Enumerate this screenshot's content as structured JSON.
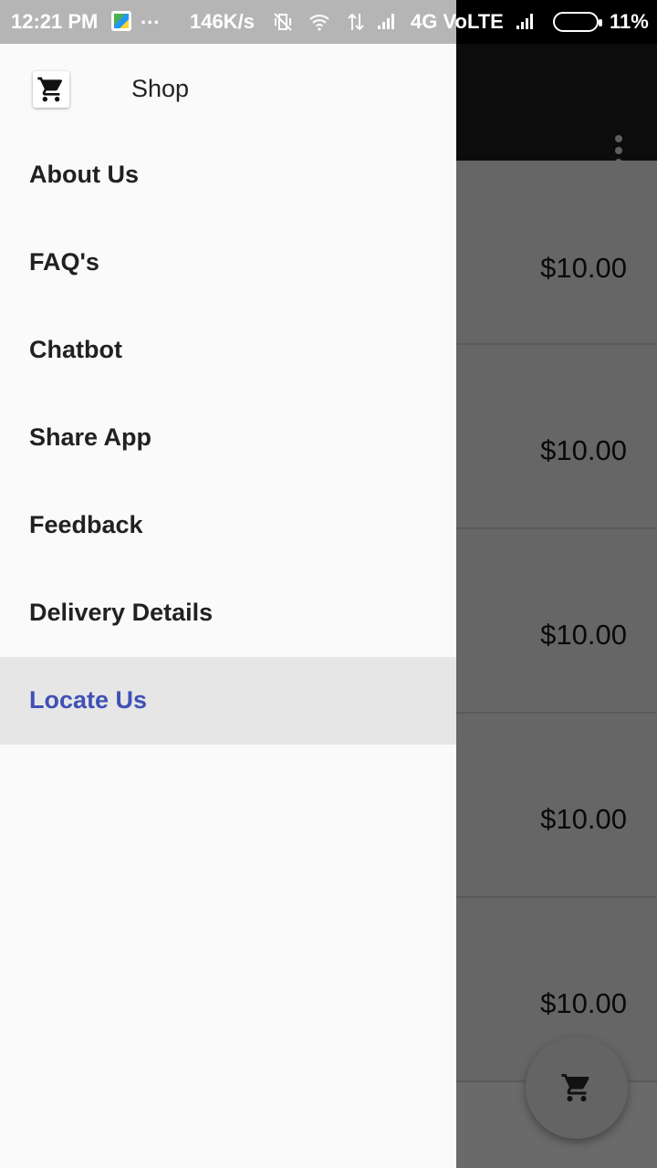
{
  "status_bar": {
    "time": "12:21 PM",
    "dots": "...",
    "speed": "146K/s",
    "network": "4G VoLTE",
    "battery": "11%"
  },
  "drawer": {
    "title": "Shop",
    "items": [
      {
        "label": "About Us"
      },
      {
        "label": "FAQ's"
      },
      {
        "label": "Chatbot"
      },
      {
        "label": "Share App"
      },
      {
        "label": "Feedback"
      },
      {
        "label": "Delivery Details"
      },
      {
        "label": "Locate Us",
        "selected": true
      }
    ]
  },
  "products": [
    {
      "price": "$10.00"
    },
    {
      "price": "$10.00"
    },
    {
      "price": "$10.00"
    },
    {
      "price": "$10.00"
    },
    {
      "price": "$10.00"
    }
  ],
  "colors": {
    "accent": "#3f51b5",
    "drawer_bg": "#fafafa",
    "selected_bg": "#e6e6e6"
  },
  "icons": {
    "header": "shopping-cart-icon",
    "fab": "shopping-cart-icon",
    "menu": "more-vert-icon"
  }
}
